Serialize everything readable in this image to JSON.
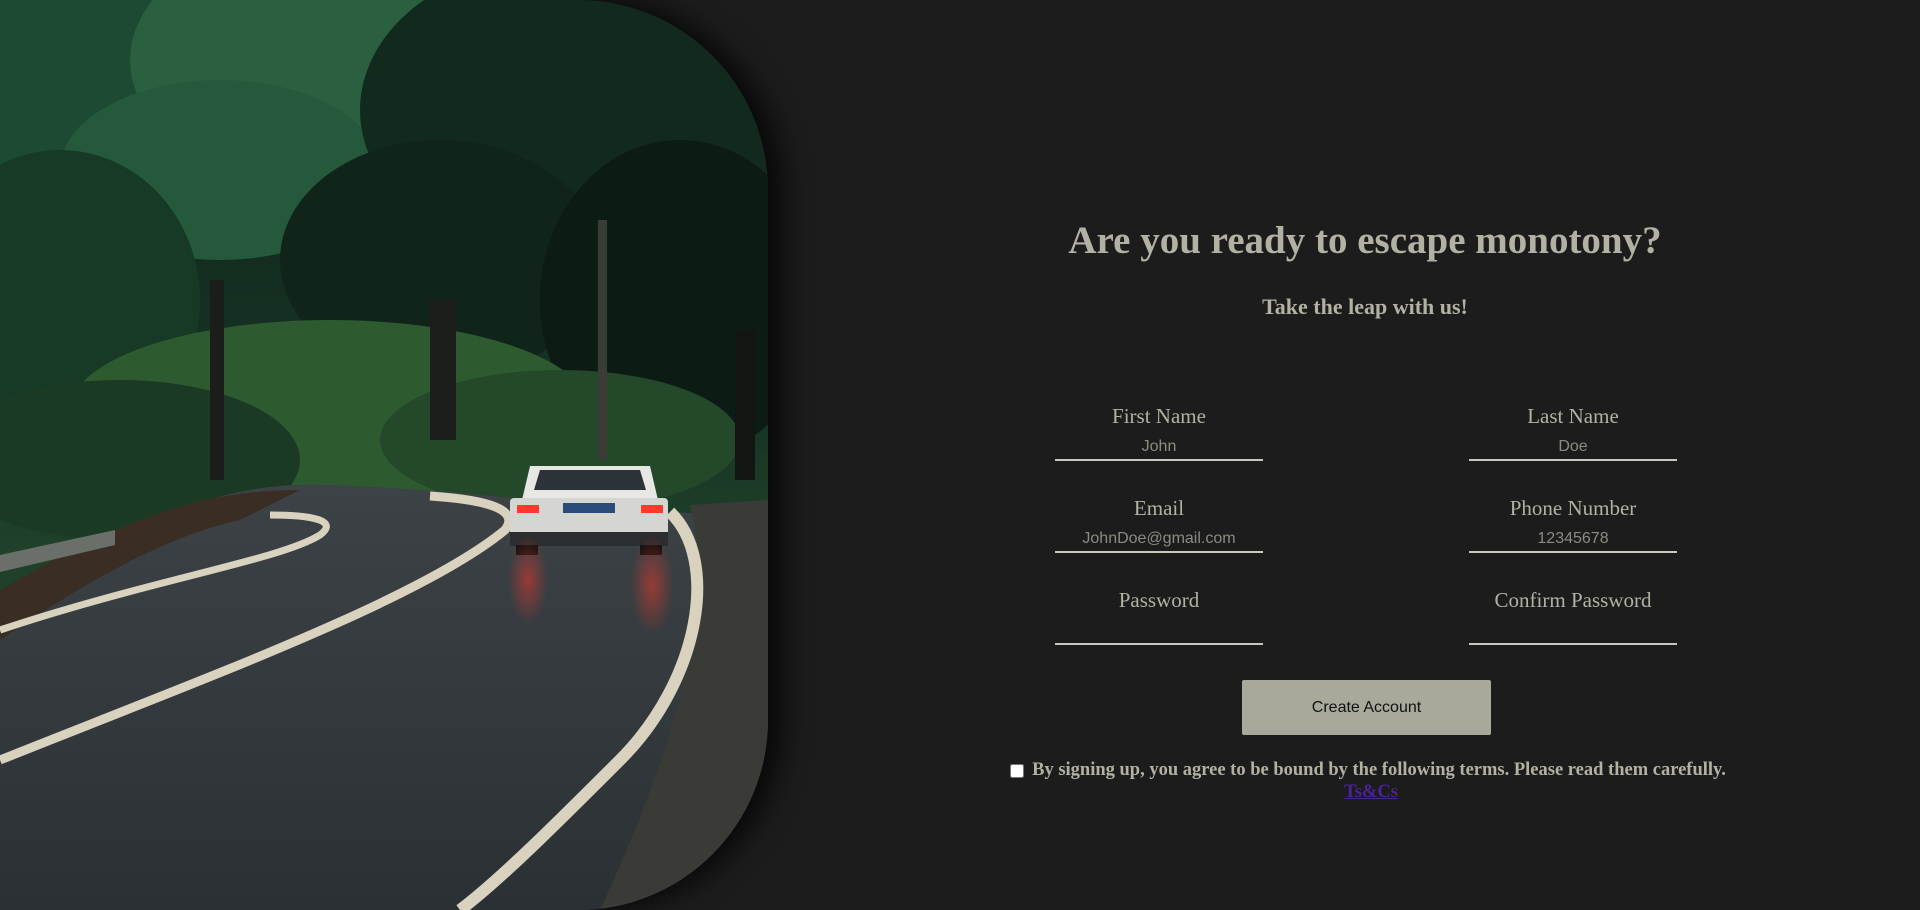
{
  "hero": {
    "image": "forest-road-car-photo"
  },
  "main": {
    "title": "Are you ready to escape monotony?",
    "subtitle": "Take the leap with us!"
  },
  "form": {
    "first_name": {
      "label": "First Name",
      "placeholder": "John",
      "value": ""
    },
    "last_name": {
      "label": "Last Name",
      "placeholder": "Doe",
      "value": ""
    },
    "email": {
      "label": "Email",
      "placeholder": "JohnDoe@gmail.com",
      "value": ""
    },
    "phone": {
      "label": "Phone Number",
      "placeholder": "12345678",
      "value": ""
    },
    "password": {
      "label": "Password",
      "placeholder": "",
      "value": ""
    },
    "confirm_password": {
      "label": "Confirm Password",
      "placeholder": "",
      "value": ""
    },
    "submit_label": "Create Account"
  },
  "terms": {
    "text": "By signing up, you agree to be bound by the following terms. Please read them carefully.",
    "link_label": "Ts&Cs",
    "checked": false
  },
  "colors": {
    "background": "#1c1c1c",
    "text": "#b2b1a3",
    "button": "#a9a99b",
    "link": "#4b2296"
  }
}
